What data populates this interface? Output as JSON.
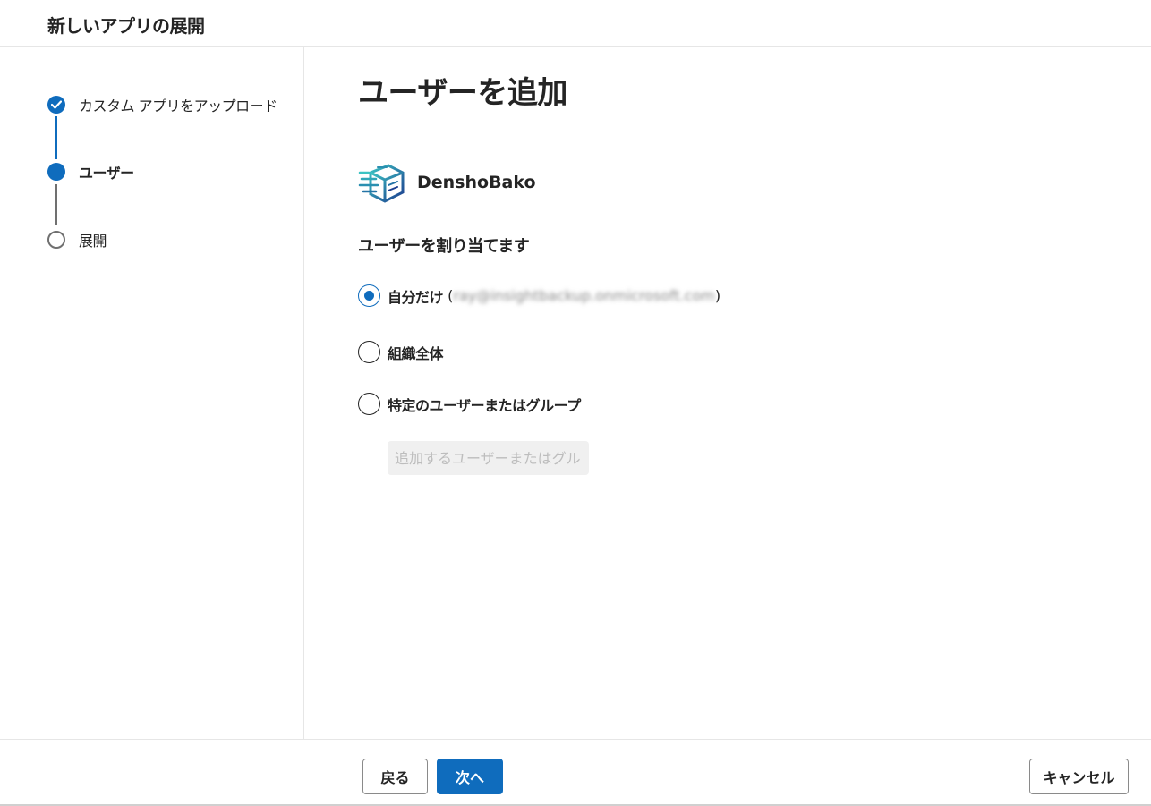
{
  "header": {
    "title": "新しいアプリの展開"
  },
  "steps": [
    {
      "label": "カスタム アプリをアップロード",
      "state": "done"
    },
    {
      "label": "ユーザー",
      "state": "current"
    },
    {
      "label": "展開",
      "state": "todo"
    }
  ],
  "main": {
    "title": "ユーザーを追加",
    "app": {
      "name": "DenshoBako",
      "icon": "densho-bako-logo-icon"
    },
    "assign_title": "ユーザーを割り当てます",
    "options": [
      {
        "label": "自分だけ",
        "email_open": "(",
        "email": "ray@insightbackup.onmicrosoft.com",
        "email_close": ")",
        "checked": true
      },
      {
        "label": "組織全体",
        "checked": false
      },
      {
        "label": "特定のユーザーまたはグループ",
        "checked": false
      }
    ],
    "search": {
      "placeholder": "追加するユーザーまたはグル...",
      "value": ""
    }
  },
  "footer": {
    "back_label": "戻る",
    "next_label": "次へ",
    "cancel_label": "キャンセル"
  },
  "colors": {
    "accent": "#0f6cbd",
    "text": "#242424",
    "border": "#e6e6e6"
  }
}
